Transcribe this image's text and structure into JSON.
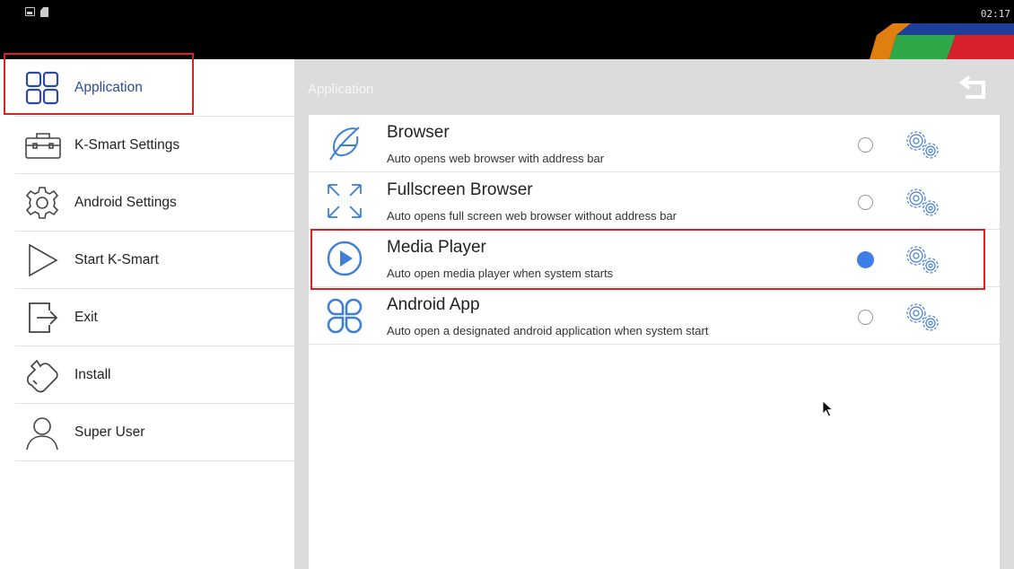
{
  "status_bar": {
    "time": "02:17",
    "icons": [
      "image-notification-icon",
      "sd-card-icon"
    ]
  },
  "colors": {
    "accent": "#2e4aa0",
    "radio_checked": "#3d7ee8",
    "highlight": "#e02020",
    "panel": "#dcdcdc",
    "gear": "#3f7fd6"
  },
  "sidebar": {
    "items": [
      {
        "label": "Application",
        "icon": "grid-icon",
        "active": true
      },
      {
        "label": "K-Smart Settings",
        "icon": "toolbox-icon"
      },
      {
        "label": "Android Settings",
        "icon": "gear-icon"
      },
      {
        "label": "Start K-Smart",
        "icon": "play-icon"
      },
      {
        "label": "Exit",
        "icon": "exit-icon"
      },
      {
        "label": "Install",
        "icon": "wrench-icon"
      },
      {
        "label": "Super User",
        "icon": "user-icon"
      }
    ]
  },
  "main": {
    "title": "Application",
    "back_icon": "back-arrow-icon",
    "options": [
      {
        "title": "Browser",
        "description": "Auto opens web browser with address bar",
        "icon": "browser-icon",
        "selected": false
      },
      {
        "title": "Fullscreen Browser",
        "description": "Auto opens full screen web browser without address bar",
        "icon": "fullscreen-icon",
        "selected": false
      },
      {
        "title": "Media Player",
        "description": "Auto open media player when system starts",
        "icon": "play-circle-icon",
        "selected": true
      },
      {
        "title": "Android App",
        "description": "Auto open a designated android application when system start",
        "icon": "app-grid-icon",
        "selected": false
      }
    ]
  }
}
